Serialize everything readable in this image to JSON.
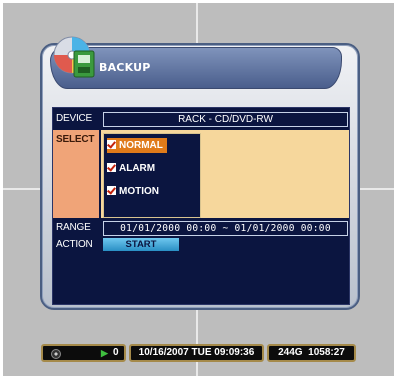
{
  "dialog": {
    "title": "BACKUP",
    "labels": {
      "device": "DEVICE",
      "select": "SELECT",
      "range": "RANGE",
      "action": "ACTION"
    },
    "device_value": "RACK - CD/DVD-RW",
    "options": [
      {
        "label": "NORMAL",
        "checked": true,
        "selected": true
      },
      {
        "label": "ALARM",
        "checked": true,
        "selected": false
      },
      {
        "label": "MOTION",
        "checked": true,
        "selected": false
      }
    ],
    "range_value": "01/01/2000 00:00 ~ 01/01/2000 00:00",
    "start_label": "START"
  },
  "status_bar": {
    "camera_icon": "camera-icon",
    "hdd_icon": "hdd-icon",
    "count": "0",
    "datetime": "10/16/2007 TUE 09:09:36",
    "storage": "244G",
    "time": "1058:27"
  },
  "colors": {
    "background": "#bdbdbd",
    "panel": "#0b1540",
    "select_label": "#f0a478",
    "select_area": "#f6d79c",
    "highlight": "#e07b1a",
    "start_button": "#3aa6dc",
    "title_bar": "#5b6f9c"
  }
}
